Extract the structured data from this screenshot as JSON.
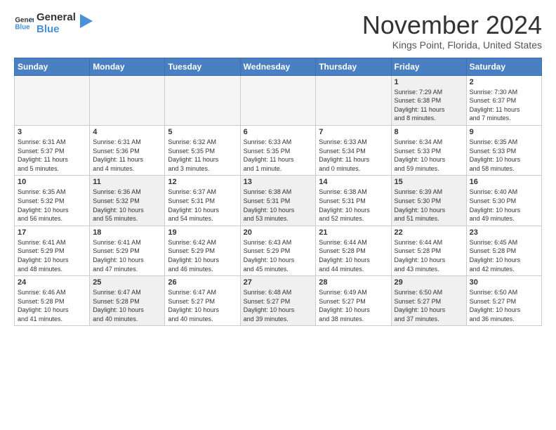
{
  "header": {
    "logo_general": "General",
    "logo_blue": "Blue",
    "month_year": "November 2024",
    "location": "Kings Point, Florida, United States"
  },
  "weekdays": [
    "Sunday",
    "Monday",
    "Tuesday",
    "Wednesday",
    "Thursday",
    "Friday",
    "Saturday"
  ],
  "weeks": [
    [
      {
        "day": "",
        "info": ""
      },
      {
        "day": "",
        "info": ""
      },
      {
        "day": "",
        "info": ""
      },
      {
        "day": "",
        "info": ""
      },
      {
        "day": "",
        "info": ""
      },
      {
        "day": "1",
        "info": "Sunrise: 7:29 AM\nSunset: 6:38 PM\nDaylight: 11 hours\nand 8 minutes."
      },
      {
        "day": "2",
        "info": "Sunrise: 7:30 AM\nSunset: 6:37 PM\nDaylight: 11 hours\nand 7 minutes."
      }
    ],
    [
      {
        "day": "3",
        "info": "Sunrise: 6:31 AM\nSunset: 5:37 PM\nDaylight: 11 hours\nand 5 minutes."
      },
      {
        "day": "4",
        "info": "Sunrise: 6:31 AM\nSunset: 5:36 PM\nDaylight: 11 hours\nand 4 minutes."
      },
      {
        "day": "5",
        "info": "Sunrise: 6:32 AM\nSunset: 5:35 PM\nDaylight: 11 hours\nand 3 minutes."
      },
      {
        "day": "6",
        "info": "Sunrise: 6:33 AM\nSunset: 5:35 PM\nDaylight: 11 hours\nand 1 minute."
      },
      {
        "day": "7",
        "info": "Sunrise: 6:33 AM\nSunset: 5:34 PM\nDaylight: 11 hours\nand 0 minutes."
      },
      {
        "day": "8",
        "info": "Sunrise: 6:34 AM\nSunset: 5:33 PM\nDaylight: 10 hours\nand 59 minutes."
      },
      {
        "day": "9",
        "info": "Sunrise: 6:35 AM\nSunset: 5:33 PM\nDaylight: 10 hours\nand 58 minutes."
      }
    ],
    [
      {
        "day": "10",
        "info": "Sunrise: 6:35 AM\nSunset: 5:32 PM\nDaylight: 10 hours\nand 56 minutes."
      },
      {
        "day": "11",
        "info": "Sunrise: 6:36 AM\nSunset: 5:32 PM\nDaylight: 10 hours\nand 55 minutes."
      },
      {
        "day": "12",
        "info": "Sunrise: 6:37 AM\nSunset: 5:31 PM\nDaylight: 10 hours\nand 54 minutes."
      },
      {
        "day": "13",
        "info": "Sunrise: 6:38 AM\nSunset: 5:31 PM\nDaylight: 10 hours\nand 53 minutes."
      },
      {
        "day": "14",
        "info": "Sunrise: 6:38 AM\nSunset: 5:31 PM\nDaylight: 10 hours\nand 52 minutes."
      },
      {
        "day": "15",
        "info": "Sunrise: 6:39 AM\nSunset: 5:30 PM\nDaylight: 10 hours\nand 51 minutes."
      },
      {
        "day": "16",
        "info": "Sunrise: 6:40 AM\nSunset: 5:30 PM\nDaylight: 10 hours\nand 49 minutes."
      }
    ],
    [
      {
        "day": "17",
        "info": "Sunrise: 6:41 AM\nSunset: 5:29 PM\nDaylight: 10 hours\nand 48 minutes."
      },
      {
        "day": "18",
        "info": "Sunrise: 6:41 AM\nSunset: 5:29 PM\nDaylight: 10 hours\nand 47 minutes."
      },
      {
        "day": "19",
        "info": "Sunrise: 6:42 AM\nSunset: 5:29 PM\nDaylight: 10 hours\nand 46 minutes."
      },
      {
        "day": "20",
        "info": "Sunrise: 6:43 AM\nSunset: 5:29 PM\nDaylight: 10 hours\nand 45 minutes."
      },
      {
        "day": "21",
        "info": "Sunrise: 6:44 AM\nSunset: 5:28 PM\nDaylight: 10 hours\nand 44 minutes."
      },
      {
        "day": "22",
        "info": "Sunrise: 6:44 AM\nSunset: 5:28 PM\nDaylight: 10 hours\nand 43 minutes."
      },
      {
        "day": "23",
        "info": "Sunrise: 6:45 AM\nSunset: 5:28 PM\nDaylight: 10 hours\nand 42 minutes."
      }
    ],
    [
      {
        "day": "24",
        "info": "Sunrise: 6:46 AM\nSunset: 5:28 PM\nDaylight: 10 hours\nand 41 minutes."
      },
      {
        "day": "25",
        "info": "Sunrise: 6:47 AM\nSunset: 5:28 PM\nDaylight: 10 hours\nand 40 minutes."
      },
      {
        "day": "26",
        "info": "Sunrise: 6:47 AM\nSunset: 5:27 PM\nDaylight: 10 hours\nand 40 minutes."
      },
      {
        "day": "27",
        "info": "Sunrise: 6:48 AM\nSunset: 5:27 PM\nDaylight: 10 hours\nand 39 minutes."
      },
      {
        "day": "28",
        "info": "Sunrise: 6:49 AM\nSunset: 5:27 PM\nDaylight: 10 hours\nand 38 minutes."
      },
      {
        "day": "29",
        "info": "Sunrise: 6:50 AM\nSunset: 5:27 PM\nDaylight: 10 hours\nand 37 minutes."
      },
      {
        "day": "30",
        "info": "Sunrise: 6:50 AM\nSunset: 5:27 PM\nDaylight: 10 hours\nand 36 minutes."
      }
    ]
  ]
}
